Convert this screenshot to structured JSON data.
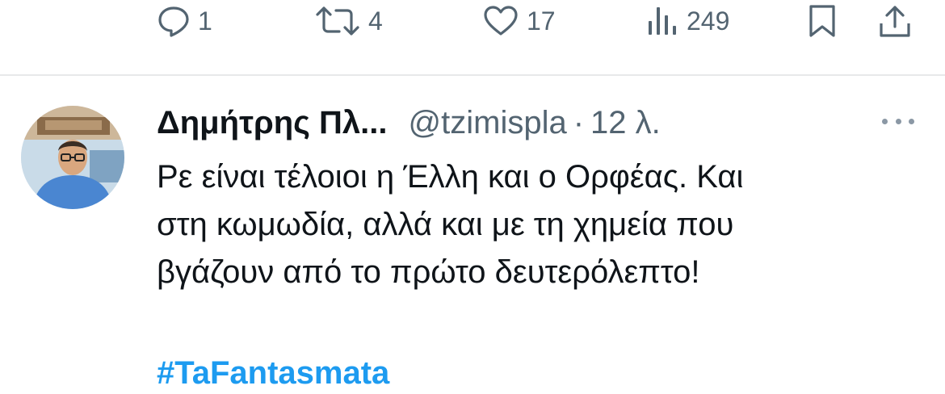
{
  "actions": {
    "reply": {
      "icon": "reply-icon",
      "count": "1"
    },
    "retweet": {
      "icon": "retweet-icon",
      "count": "4"
    },
    "like": {
      "icon": "heart-icon",
      "count": "17"
    },
    "views": {
      "icon": "views-icon",
      "count": "249"
    },
    "bookmark": {
      "icon": "bookmark-icon"
    },
    "share": {
      "icon": "share-icon"
    }
  },
  "tweet": {
    "author_name": "Δημήτρης Πλ...",
    "handle": "@tzimispla",
    "separator": "·",
    "time": "12 λ.",
    "text_lines": [
      "Ρε είναι τέλοιοι η Έλλη και ο Ορφέας. Και",
      "στη κωμωδία, αλλά και με τη χημεία που",
      "βγάζουν από το πρώτο δευτερόλεπτο!"
    ],
    "hashtag": "#TaFantasmata"
  },
  "colors": {
    "text": "#0f1419",
    "secondary": "#536471",
    "link": "#1d9bf0",
    "divider": "#e7e9ea"
  }
}
